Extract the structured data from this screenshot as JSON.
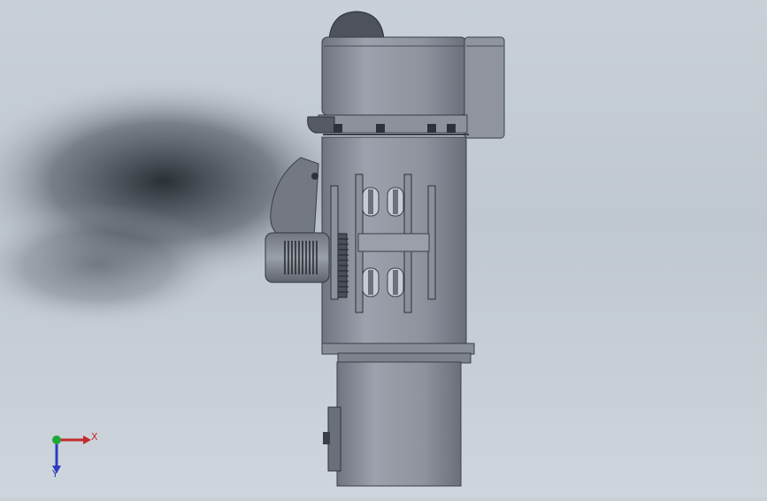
{
  "viewport": {
    "background_top": "#c9d0d8",
    "background_shadow": "#2b3138",
    "metal_light": "#a3a8b2",
    "metal_dark": "#5b606b"
  },
  "triad": {
    "x_label": "X",
    "y_label": "Y",
    "x_color": "#c22b2b",
    "y_color": "#2b3cc2",
    "origin_color": "#1fa83a"
  }
}
